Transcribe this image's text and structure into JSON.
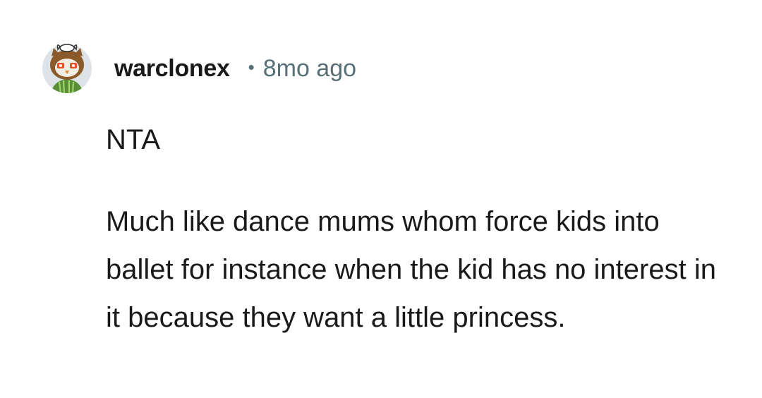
{
  "comment": {
    "username": "warclonex",
    "separator": "•",
    "age": "8mo ago",
    "paragraphs": [
      "NTA",
      "Much like dance mums whom force kids into ballet for instance when the kid has no interest in it because they want a little princess."
    ],
    "avatar_icon": "owl-avatar-icon"
  },
  "colors": {
    "text": "#1a1a1b",
    "meta": "#576f76",
    "avatar_bg": "#dde3e6"
  }
}
